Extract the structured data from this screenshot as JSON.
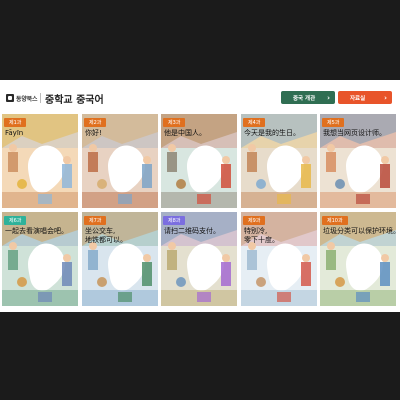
{
  "header": {
    "publisher": "동양북스",
    "title": "중학교 중국어",
    "buttons": [
      {
        "label": "중국 개관",
        "icon": "chevron-right-icon",
        "color": "#2f6e52"
      },
      {
        "label": "자료실",
        "icon": "chevron-right-icon",
        "color": "#e8542a"
      }
    ]
  },
  "lessons": [
    {
      "tag": "제1과",
      "text": "Fāyīn",
      "tag_color": "#e0701f"
    },
    {
      "tag": "제2과",
      "text": "你好!",
      "tag_color": "#e0701f"
    },
    {
      "tag": "제3과",
      "text": "他是中国人。",
      "tag_color": "#e0701f"
    },
    {
      "tag": "제4과",
      "text": "今天是我的生日。",
      "tag_color": "#e0701f"
    },
    {
      "tag": "제5과",
      "text": "我想当网页设计师。",
      "tag_color": "#e0701f"
    },
    {
      "tag": "제6과",
      "text": "一起去看演唱会吧。",
      "tag_color": "#2fb29a"
    },
    {
      "tag": "제7과",
      "text": "坐公交车,\n地铁都可以。",
      "tag_color": "#e0701f"
    },
    {
      "tag": "제8과",
      "text": "请扫二维码支付。",
      "tag_color": "#7b6ee0"
    },
    {
      "tag": "제9과",
      "text": "特别冷,\n零下十度。",
      "tag_color": "#e0701f"
    },
    {
      "tag": "제10과",
      "text": "垃圾分类可以保护环境。",
      "tag_color": "#e0701f"
    }
  ]
}
